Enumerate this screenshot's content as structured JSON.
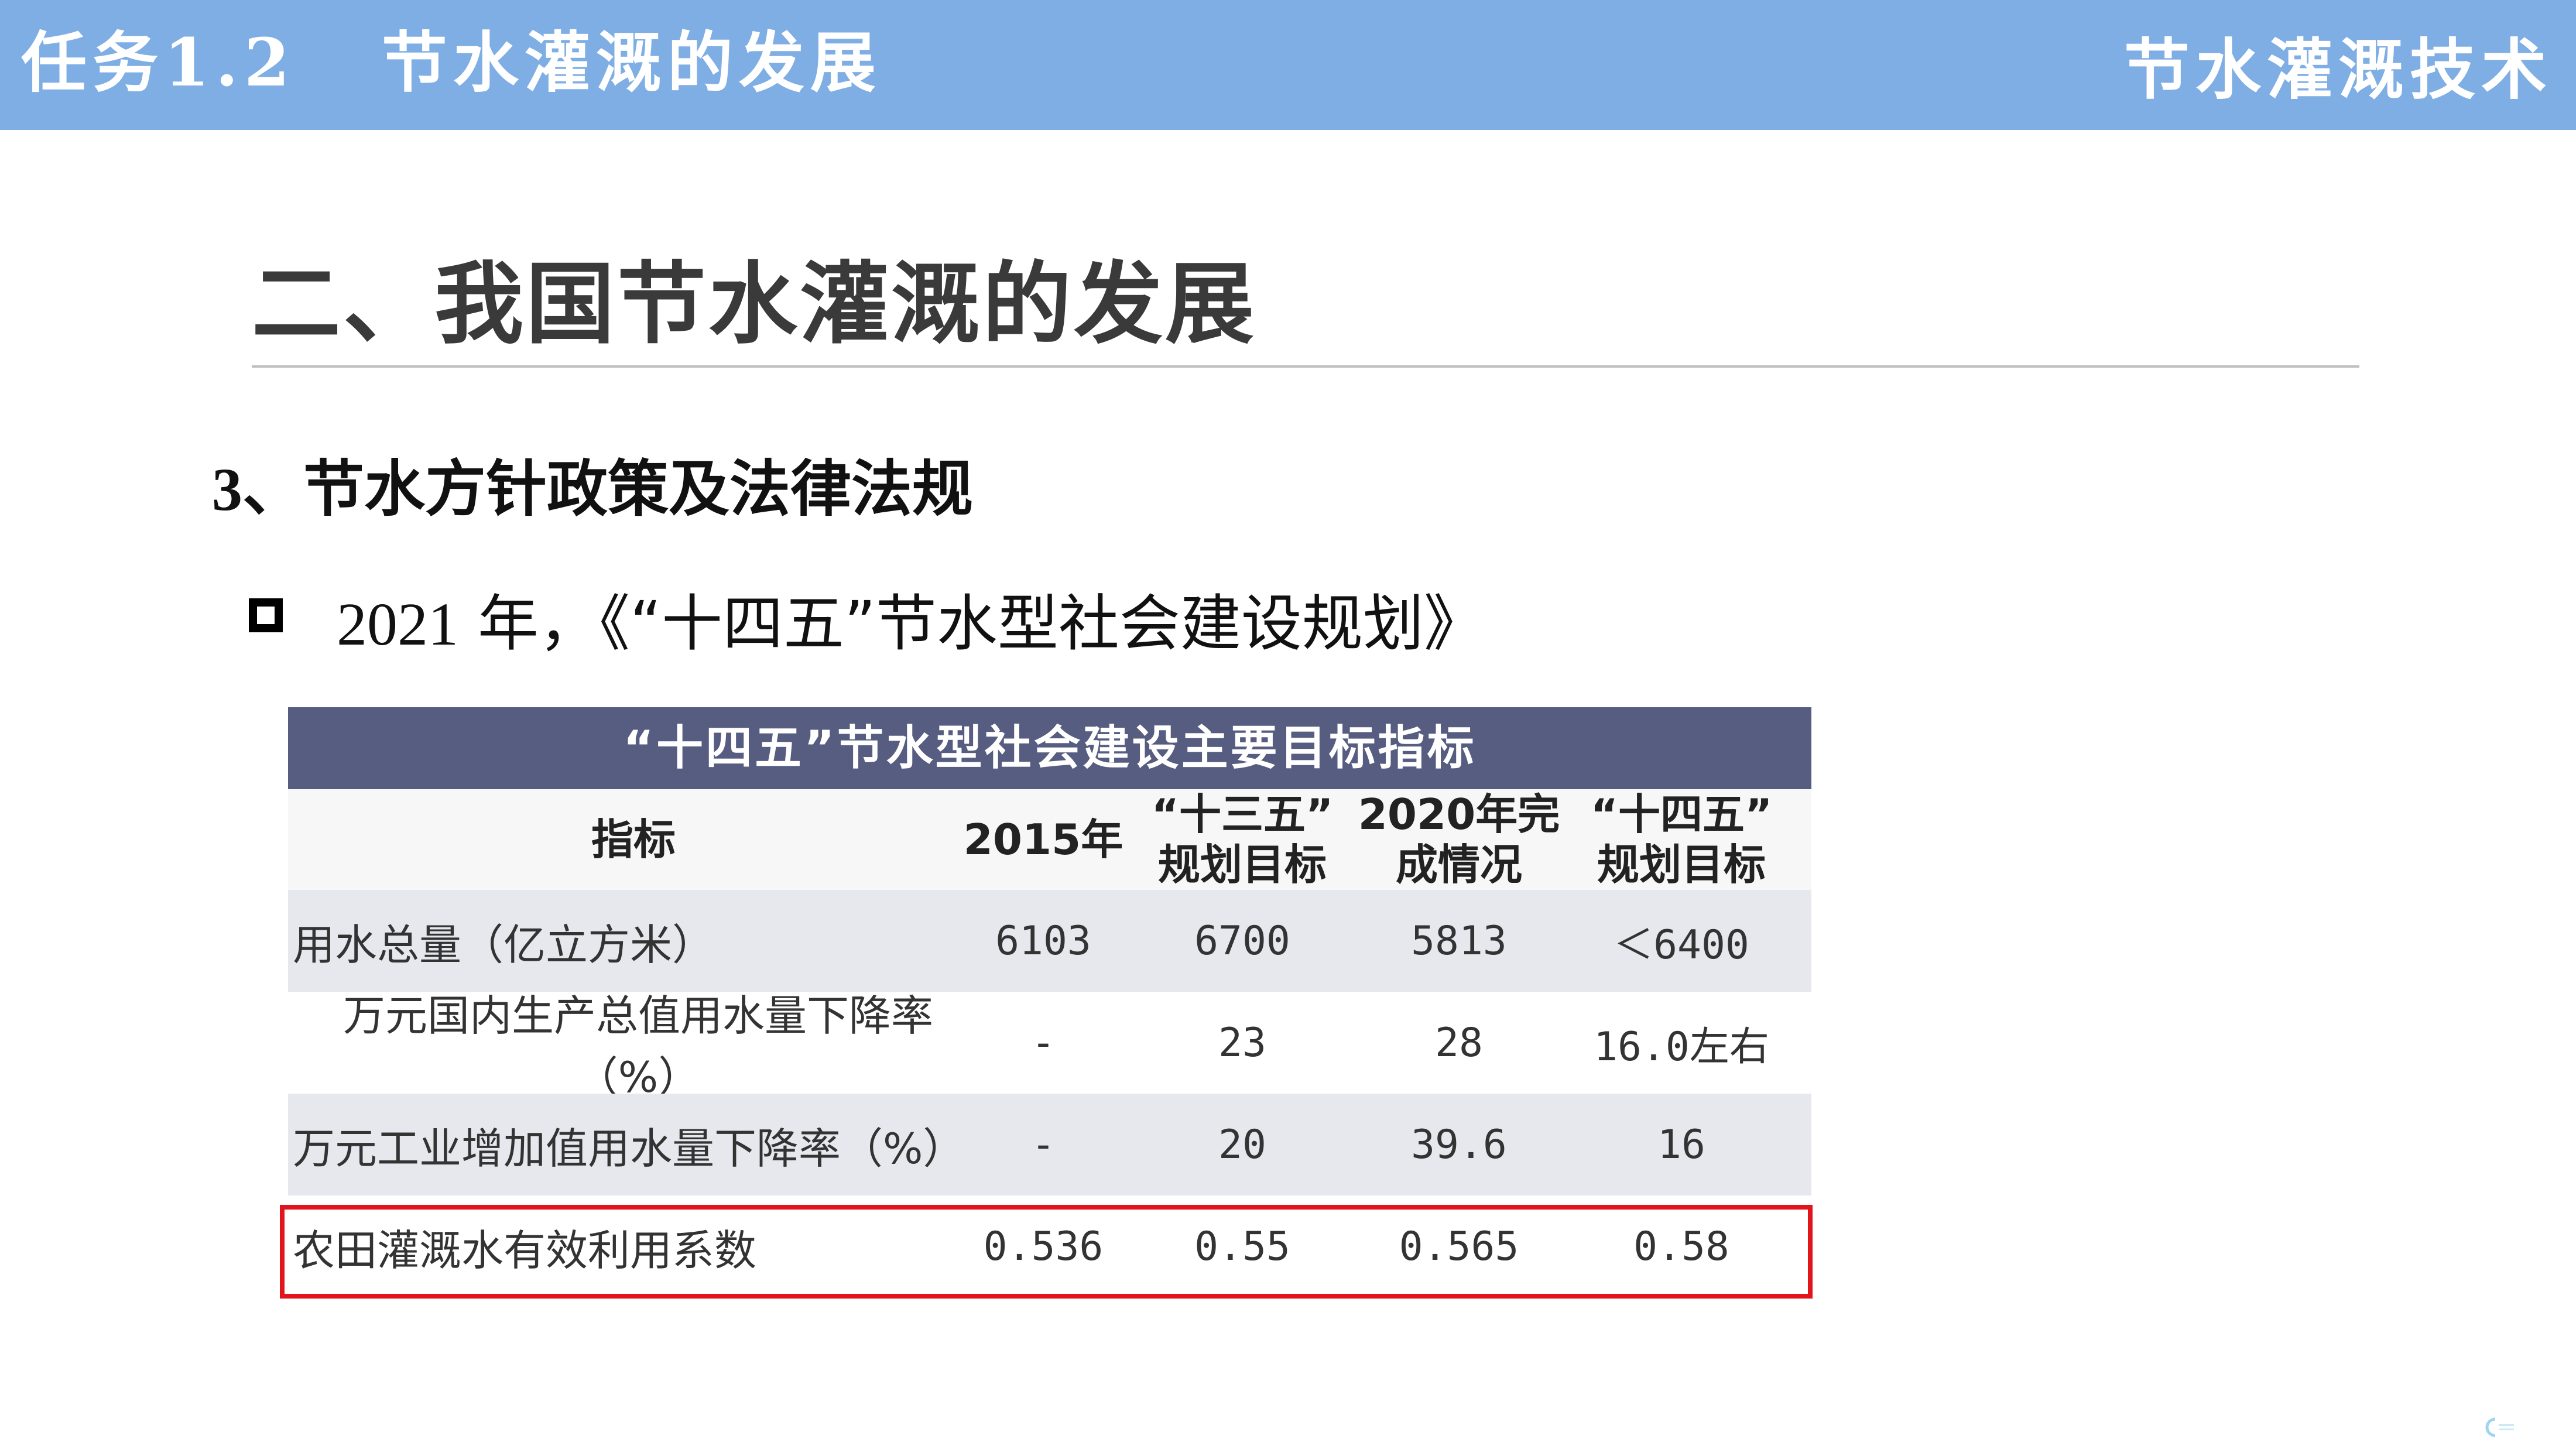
{
  "header": {
    "task_title": "任务1.2   节水灌溉的发展",
    "course_title": "节水灌溉技术"
  },
  "section_heading": "二、我国节水灌溉的发展",
  "sub_heading": {
    "number": "3",
    "text": "、节水方针政策及法律法规"
  },
  "bullet": {
    "year": "2021",
    "text": " 年，《“十四五”节水型社会建设规划》"
  },
  "table": {
    "title": "“十四五”节水型社会建设主要目标指标",
    "headers": [
      "指标",
      "2015年",
      "“十三五”\n规划目标",
      "2020年完\n成情况",
      "“十四五”\n规划目标"
    ],
    "rows": [
      [
        "用水总量（亿立方米）",
        "6103",
        "6700",
        "5813",
        "＜6400"
      ],
      [
        "万元国内生产总值用水量下降率（%）",
        "-",
        "23",
        "28",
        "16.0左右"
      ],
      [
        "万元工业增加值用水量下降率（%）",
        "-",
        "20",
        "39.6",
        "16"
      ],
      [
        "农田灌溉水有效利用系数",
        "0.536",
        "0.55",
        "0.565",
        "0.58"
      ]
    ],
    "highlighted_row": 4,
    "highlight_color": "#e1151b",
    "title_bar_color": "#565d80"
  },
  "colors": {
    "top_bar": "#7eaee3"
  }
}
